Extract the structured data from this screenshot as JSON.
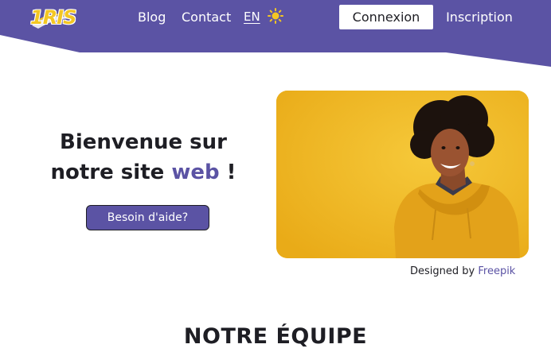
{
  "header": {
    "logo_text": "1RIS",
    "nav": {
      "blog": "Blog",
      "contact": "Contact",
      "language": "EN"
    },
    "theme_icon": "sun-icon",
    "login_label": "Connexion",
    "signup_label": "Inscription"
  },
  "hero": {
    "title_line1": "Bienvenue sur",
    "title_line2_start": "notre site ",
    "title_accent": "web",
    "title_line2_end": " !",
    "help_button": "Besoin d'aide?",
    "image_alt": "Smiling woman in a yellow hoodie on a yellow background"
  },
  "credit": {
    "prefix": "Designed by ",
    "link": "Freepik"
  },
  "team": {
    "title": "NOTRE ÉQUIPE"
  },
  "colors": {
    "brand_purple": "#5b53a4",
    "logo_yellow": "#f3c623",
    "photo_yellow": "#f0b925"
  }
}
